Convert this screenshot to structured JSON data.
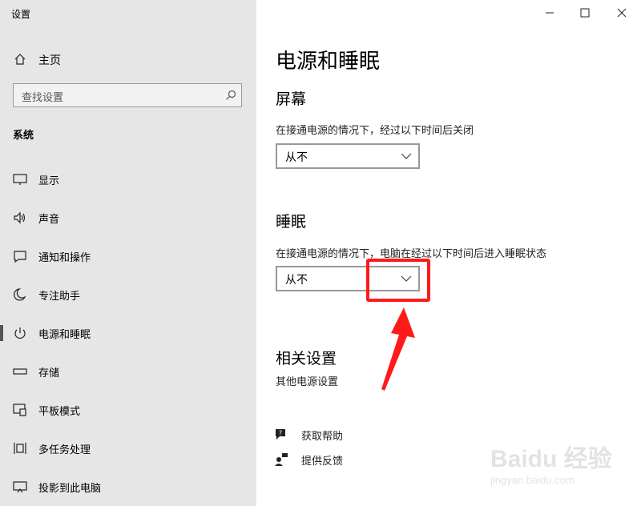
{
  "app_title": "设置",
  "sidebar": {
    "home_label": "主页",
    "search_placeholder": "查找设置",
    "section_label": "系统",
    "items": [
      {
        "label": "显示",
        "icon": "monitor-icon"
      },
      {
        "label": "声音",
        "icon": "speaker-icon"
      },
      {
        "label": "通知和操作",
        "icon": "notification-icon"
      },
      {
        "label": "专注助手",
        "icon": "moon-icon"
      },
      {
        "label": "电源和睡眠",
        "icon": "power-icon",
        "active": true
      },
      {
        "label": "存储",
        "icon": "storage-icon"
      },
      {
        "label": "平板模式",
        "icon": "tablet-icon"
      },
      {
        "label": "多任务处理",
        "icon": "multitask-icon"
      },
      {
        "label": "投影到此电脑",
        "icon": "project-icon"
      }
    ]
  },
  "main": {
    "title": "电源和睡眠",
    "screen": {
      "heading": "屏幕",
      "desc": "在接通电源的情况下，经过以下时间后关闭",
      "value": "从不"
    },
    "sleep": {
      "heading": "睡眠",
      "desc": "在接通电源的情况下，电脑在经过以下时间后进入睡眠状态",
      "value": "从不"
    },
    "related": {
      "heading": "相关设置",
      "link": "其他电源设置"
    },
    "help": {
      "get_help": "获取帮助",
      "feedback": "提供反馈"
    }
  },
  "watermark": {
    "logo": "Baidu 经验",
    "sub": "jingyan.baidu.com"
  },
  "colors": {
    "sidebar_bg": "#e6e6e6",
    "highlight": "#ff1a1a"
  }
}
